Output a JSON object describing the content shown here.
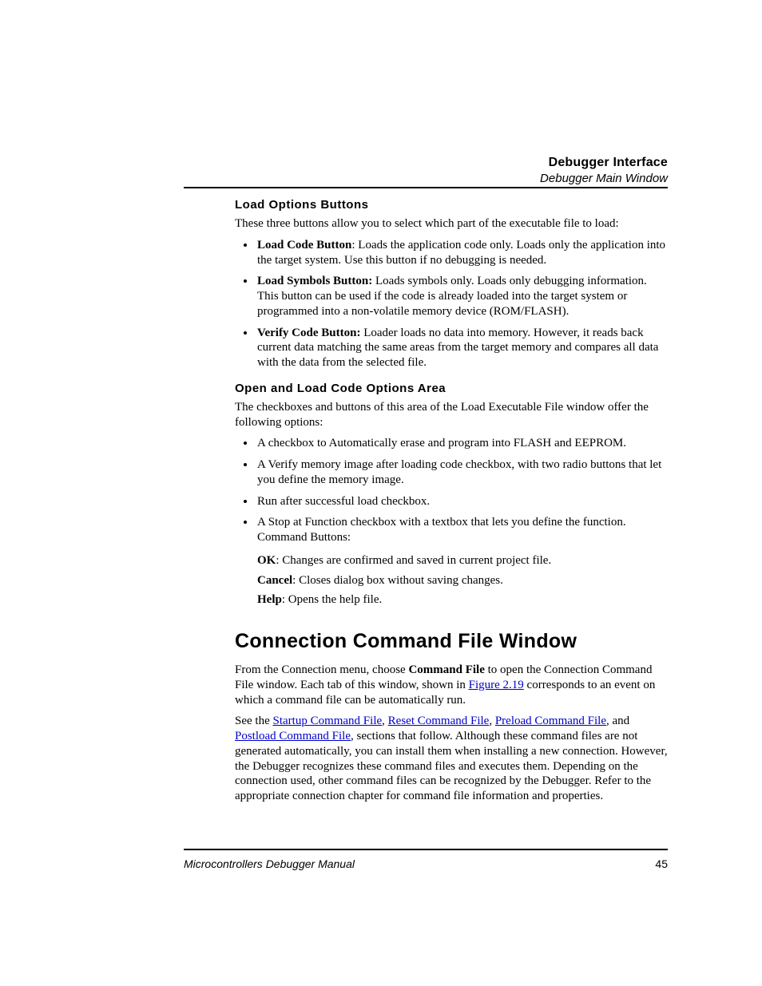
{
  "header": {
    "title": "Debugger Interface",
    "subtitle": "Debugger Main Window"
  },
  "section1": {
    "heading": "Load Options Buttons",
    "intro": "These three buttons allow you to select which part of the executable file to load:",
    "items": [
      {
        "label": "Load Code Button",
        "sep": ": ",
        "text": "Loads the application code only. Loads only the application into the target system. Use this button if no debugging is needed."
      },
      {
        "label": "Load Symbols Button:",
        "sep": " ",
        "text": "Loads symbols only. Loads only debugging information. This button can be used if the code is already loaded into the target system or programmed into a non-volatile memory device (ROM/FLASH)."
      },
      {
        "label": "Verify Code Button:",
        "sep": " ",
        "text": "Loader loads no data into memory. However, it reads back current data matching the same areas from the target memory and compares all data with the data from the selected file."
      }
    ]
  },
  "section2": {
    "heading": "Open and Load Code Options Area",
    "intro": "The checkboxes and buttons of this area of the Load Executable File window offer the following options:",
    "items": [
      "A checkbox to Automatically erase and program into FLASH and EEPROM.",
      "A Verify memory image after loading code checkbox, with two radio buttons that let you define the memory image.",
      "Run after successful load checkbox.",
      "A Stop at Function checkbox with a textbox that lets you define the function. Command Buttons:"
    ],
    "sub": [
      {
        "label": "OK",
        "text": ": Changes are confirmed and saved in current project file."
      },
      {
        "label": "Cancel",
        "text": ": Closes dialog box without saving changes."
      },
      {
        "label": "Help",
        "text": ": Opens the help file."
      }
    ]
  },
  "section3": {
    "heading": "Connection Command File Window",
    "p1_a": "From the Connection menu, choose ",
    "p1_bold": "Command File",
    "p1_b": " to open the Connection Command File window. Each tab of this window, shown in ",
    "p1_link": "Figure 2.19",
    "p1_c": " corresponds to an event on which a command file can be automatically run.",
    "p2_a": "See the ",
    "links": {
      "l1": "Startup Command File",
      "l2": "Reset Command File",
      "l3": "Preload Command File",
      "l4": "Postload Command File"
    },
    "p2_b": ", and ",
    "p2_c": ", sections that follow. Although these command files are not generated automatically, you can install them when installing a new connection. However, the Debugger recognizes these command files and executes them. Depending on the connection used, other command files can be recognized by the Debugger. Refer to the appropriate connection chapter for command file information and properties."
  },
  "footer": {
    "manual": "Microcontrollers Debugger Manual",
    "page": "45"
  }
}
